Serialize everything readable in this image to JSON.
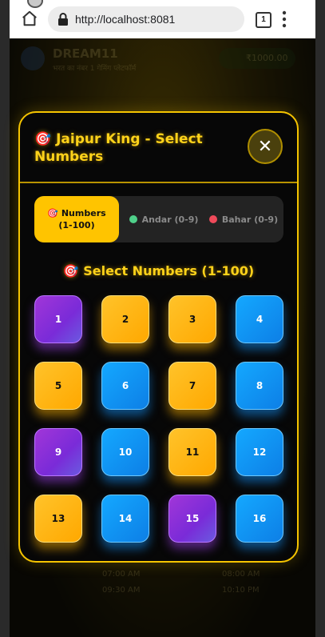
{
  "browser": {
    "url": "http://localhost:8081",
    "tab_count": "1"
  },
  "background_app": {
    "title": "DREAM11",
    "subtitle": "भरत का नंबर 1 गेमिंग प्लेटफॉर्म",
    "wallet": "₹1000.00",
    "times": [
      "07:00 AM",
      "08:00 AM",
      "09:30 AM",
      "10:10 PM"
    ]
  },
  "modal": {
    "title": "🎯 Jaipur King - Select Numbers",
    "close_label": "✕",
    "tabs": [
      {
        "label": "🎯 Numbers (1-100)",
        "active": true
      },
      {
        "label": "Andar (0-9)",
        "dot_color": "#4fd08a"
      },
      {
        "label": "Bahar (0-9)",
        "dot_color": "#ef4a5a"
      }
    ],
    "section_title": "🎯 Select Numbers (1-100)",
    "numbers": [
      {
        "value": "1",
        "color": "purple"
      },
      {
        "value": "2",
        "color": "orange"
      },
      {
        "value": "3",
        "color": "orange"
      },
      {
        "value": "4",
        "color": "blue"
      },
      {
        "value": "5",
        "color": "orange"
      },
      {
        "value": "6",
        "color": "blue"
      },
      {
        "value": "7",
        "color": "orange"
      },
      {
        "value": "8",
        "color": "blue"
      },
      {
        "value": "9",
        "color": "purple"
      },
      {
        "value": "10",
        "color": "blue"
      },
      {
        "value": "11",
        "color": "orange"
      },
      {
        "value": "12",
        "color": "blue"
      },
      {
        "value": "13",
        "color": "orange"
      },
      {
        "value": "14",
        "color": "blue"
      },
      {
        "value": "15",
        "color": "purple"
      },
      {
        "value": "16",
        "color": "blue"
      }
    ]
  },
  "colors": {
    "accent": "#ffc400",
    "purple": "#7a2bd8",
    "orange": "#ffa800",
    "blue": "#0d7fe6"
  }
}
